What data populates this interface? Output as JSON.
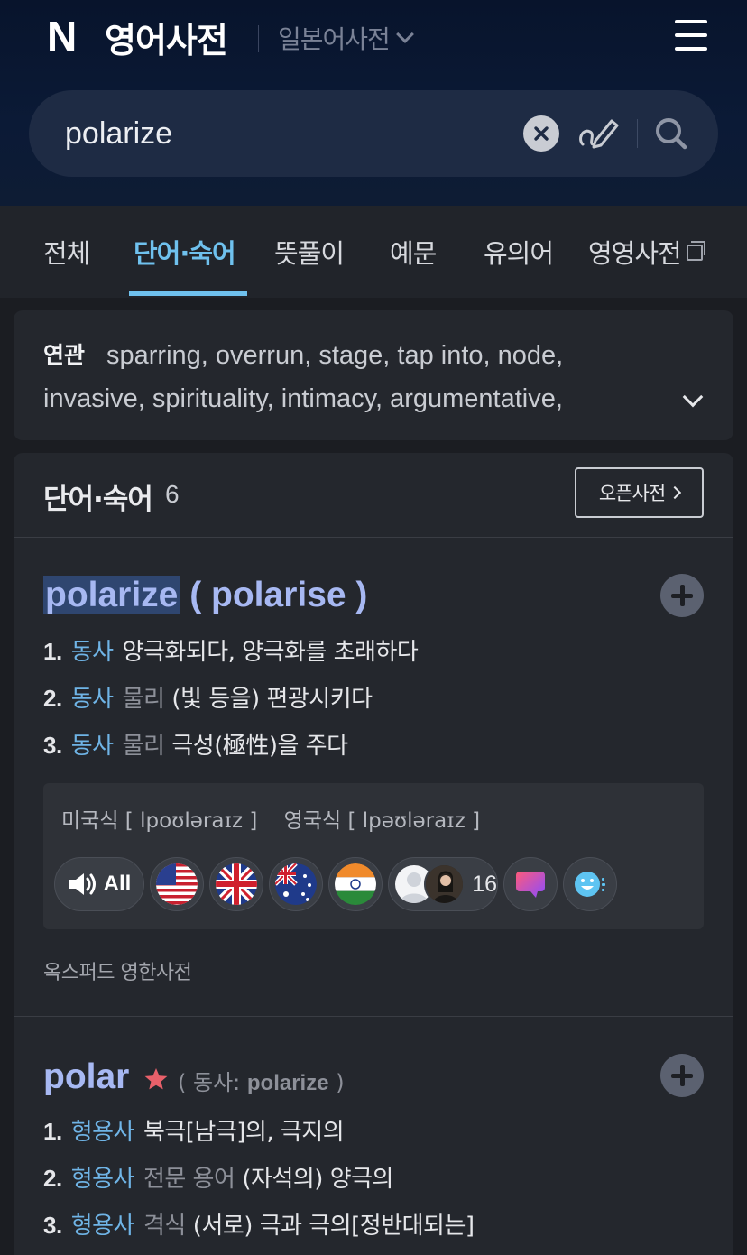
{
  "header": {
    "logo": "N",
    "service_title": "영어사전",
    "dict_switch_label": "일본어사전"
  },
  "search": {
    "query": "polarize"
  },
  "tabs": [
    {
      "label": "전체"
    },
    {
      "label": "단어·숙어",
      "active": true
    },
    {
      "label": "뜻풀이"
    },
    {
      "label": "예문"
    },
    {
      "label": "유의어"
    },
    {
      "label": "영영사전"
    }
  ],
  "related": {
    "label": "연관",
    "text": "sparring,  overrun,  stage,  tap into,  node,  invasive,  spirituality,  intimacy,  argumentative,"
  },
  "results": {
    "title": "단어·숙어",
    "count": "6",
    "open_dict_label": "오픈사전",
    "entries": [
      {
        "word": "polarize",
        "variant": " ( polarise )",
        "meanings": [
          {
            "num": "1.",
            "pos": "동사",
            "field": "",
            "text": "양극화되다, 양극화를 초래하다"
          },
          {
            "num": "2.",
            "pos": "동사",
            "field": "물리",
            "text": "(빛 등을) 편광시키다"
          },
          {
            "num": "3.",
            "pos": "동사",
            "field": "물리",
            "text": "극성(極性)을 주다"
          }
        ],
        "pronunciation": {
          "us_label": "미국식",
          "us_ipa": "[  lpoʊləraɪz  ]",
          "uk_label": "영국식",
          "uk_ipa": "[  lpəʊləraɪz  ]",
          "all_label": "All",
          "user_count": "16"
        },
        "source": "옥스퍼드 영한사전"
      },
      {
        "word": "polar",
        "verb_form_prefix": "( 동사: ",
        "verb_form_word": "polarize",
        "verb_form_suffix": " )",
        "meanings": [
          {
            "num": "1.",
            "pos": "형용사",
            "field": "",
            "text": "북극[남극]의, 극지의"
          },
          {
            "num": "2.",
            "pos": "형용사",
            "field": "전문 용어",
            "text": "(자석의) 양극의"
          },
          {
            "num": "3.",
            "pos": "형용사",
            "field": "격식",
            "text": "(서로) 극과 극의[정반대되는]"
          }
        ]
      }
    ]
  },
  "colors": {
    "header_bg": "#0b1a36",
    "accent_blue": "#6fc1ee",
    "entry_word": "#a7b8f2",
    "pos_blue": "#6fb4e6",
    "star": "#e8606a"
  }
}
